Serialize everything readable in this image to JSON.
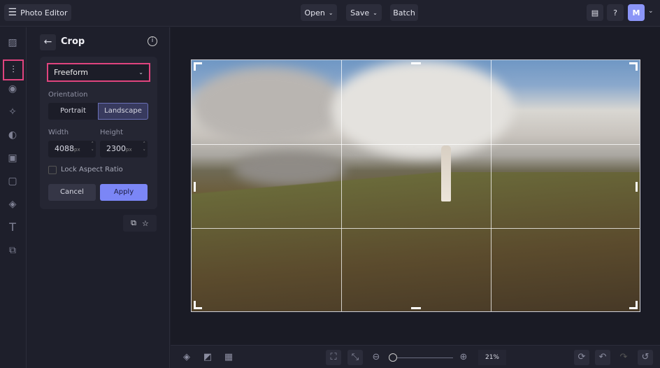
{
  "app": {
    "title": "Photo Editor",
    "avatar": "M"
  },
  "topbar": {
    "open": "Open",
    "save": "Save",
    "batch": "Batch"
  },
  "panel": {
    "title": "Crop",
    "preset": "Freeform",
    "orientation_label": "Orientation",
    "portrait": "Portrait",
    "landscape": "Landscape",
    "width_label": "Width",
    "height_label": "Height",
    "width": "4088",
    "height": "2300",
    "unit": "px",
    "lock_label": "Lock Aspect Ratio",
    "lock_checked": false,
    "cancel": "Cancel",
    "apply": "Apply"
  },
  "bottom": {
    "zoom": "21%",
    "zoom_fraction": 0.0
  },
  "colors": {
    "accent": "#7b86f6",
    "highlight": "#e0447e"
  }
}
